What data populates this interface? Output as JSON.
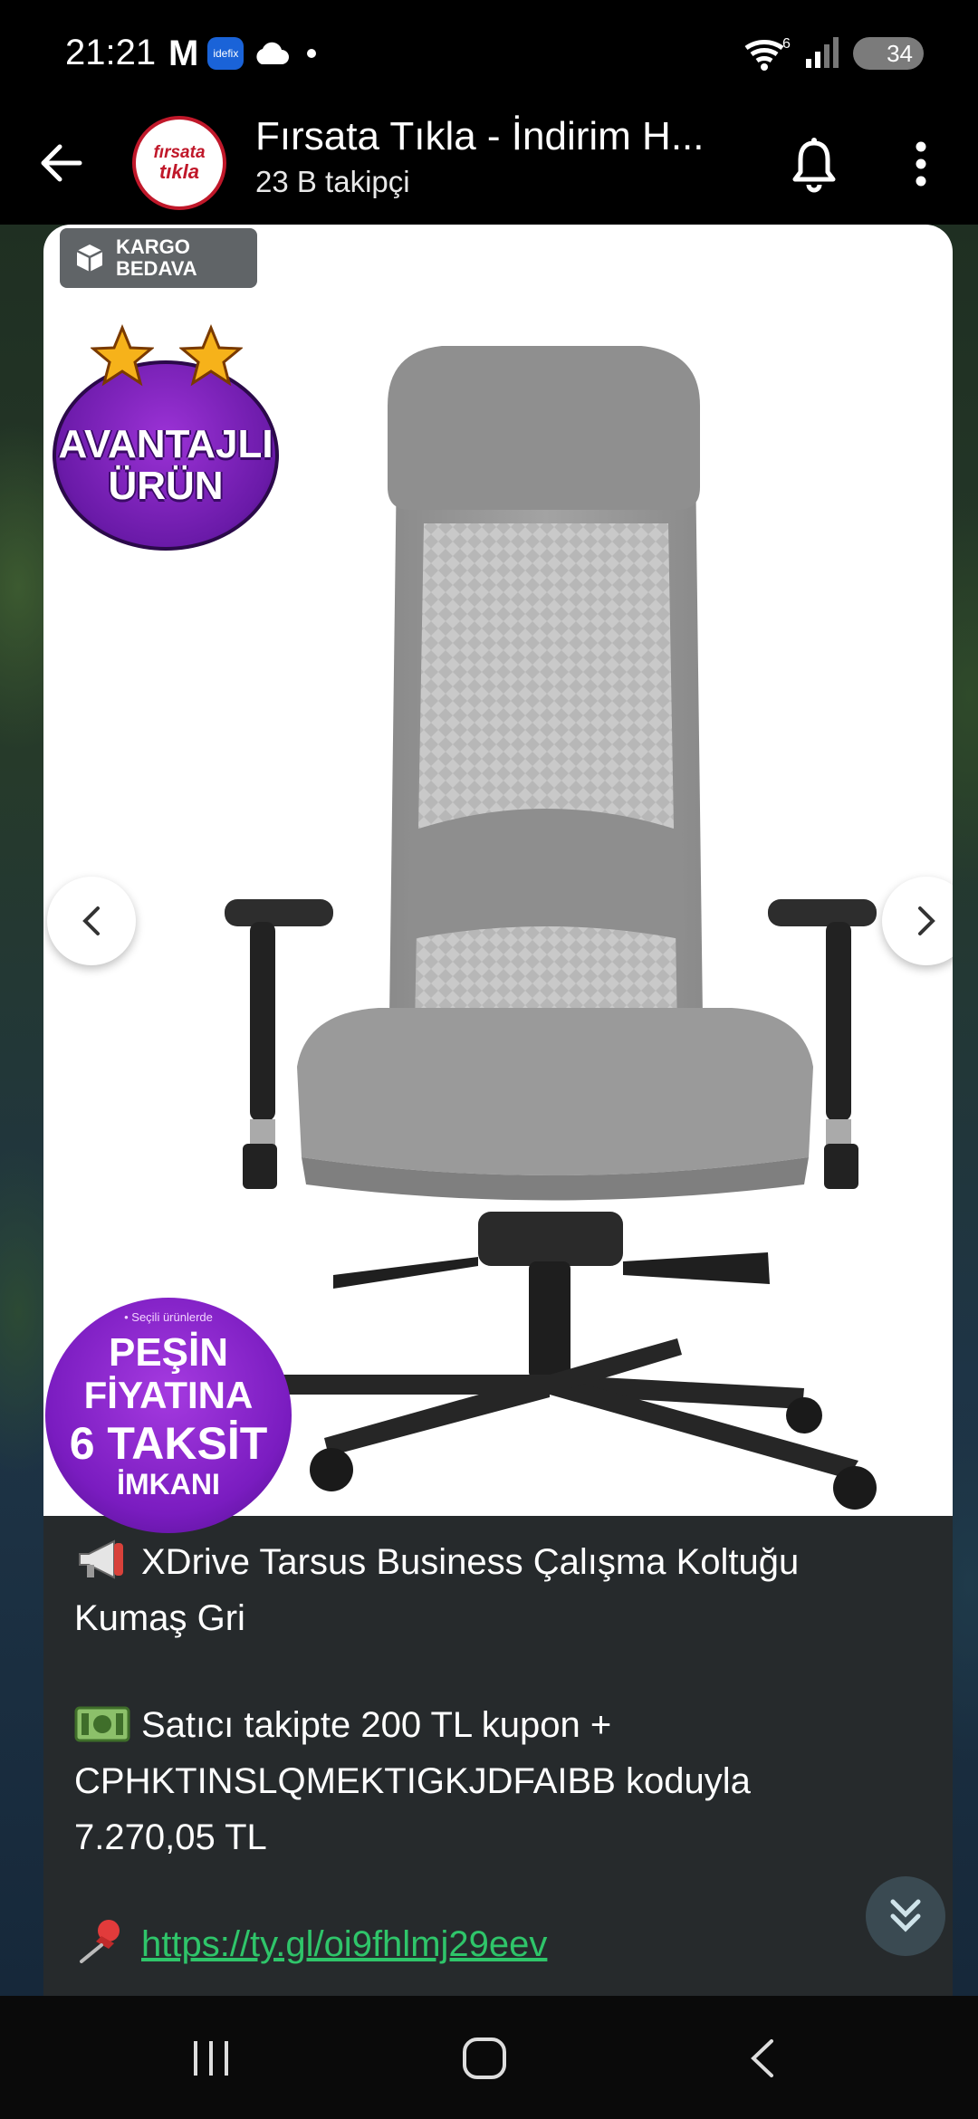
{
  "status_bar": {
    "time": "21:21",
    "gmail_icon": "M",
    "idefix_badge": "idefix",
    "battery": "34",
    "network_indicator": "6"
  },
  "header": {
    "channel_name": "Fırsata Tıkla - İndirim H...",
    "followers": "23 B takipçi",
    "avatar_line1": "fırsata",
    "avatar_line2": "tıkla"
  },
  "product": {
    "cargo_badge_line1": "KARGO",
    "cargo_badge_line2": "BEDAVA",
    "advantage_line1": "AVANTAJLI",
    "advantage_line2": "ÜRÜN",
    "taksit_small": "• Seçili ürünlerde",
    "taksit_line1": "PEŞİN",
    "taksit_line2": "FİYATINA",
    "taksit_line3": "6 TAKSİT",
    "taksit_line4": "İMKANI"
  },
  "message": {
    "title_line1": "XDrive Tarsus Business Çalışma Koltuğu",
    "title_line2": "Kumaş Gri",
    "coupon_line1": "Satıcı takipte 200 TL kupon +",
    "coupon_line2": "CPHKTINSLQMEKTIGKJDFAIBB koduyla",
    "coupon_line3": "7.270,05 TL",
    "link": "https://ty.gl/oi9fhlmj29eev"
  },
  "icons": {
    "megaphone": "megaphone-icon",
    "money": "money-icon",
    "pushpin": "pushpin-icon"
  },
  "colors": {
    "link": "#2fc56a",
    "card_bg": "#262a2c",
    "avatar_red": "#c0182a",
    "badge_purple": "#7a1cc0"
  }
}
